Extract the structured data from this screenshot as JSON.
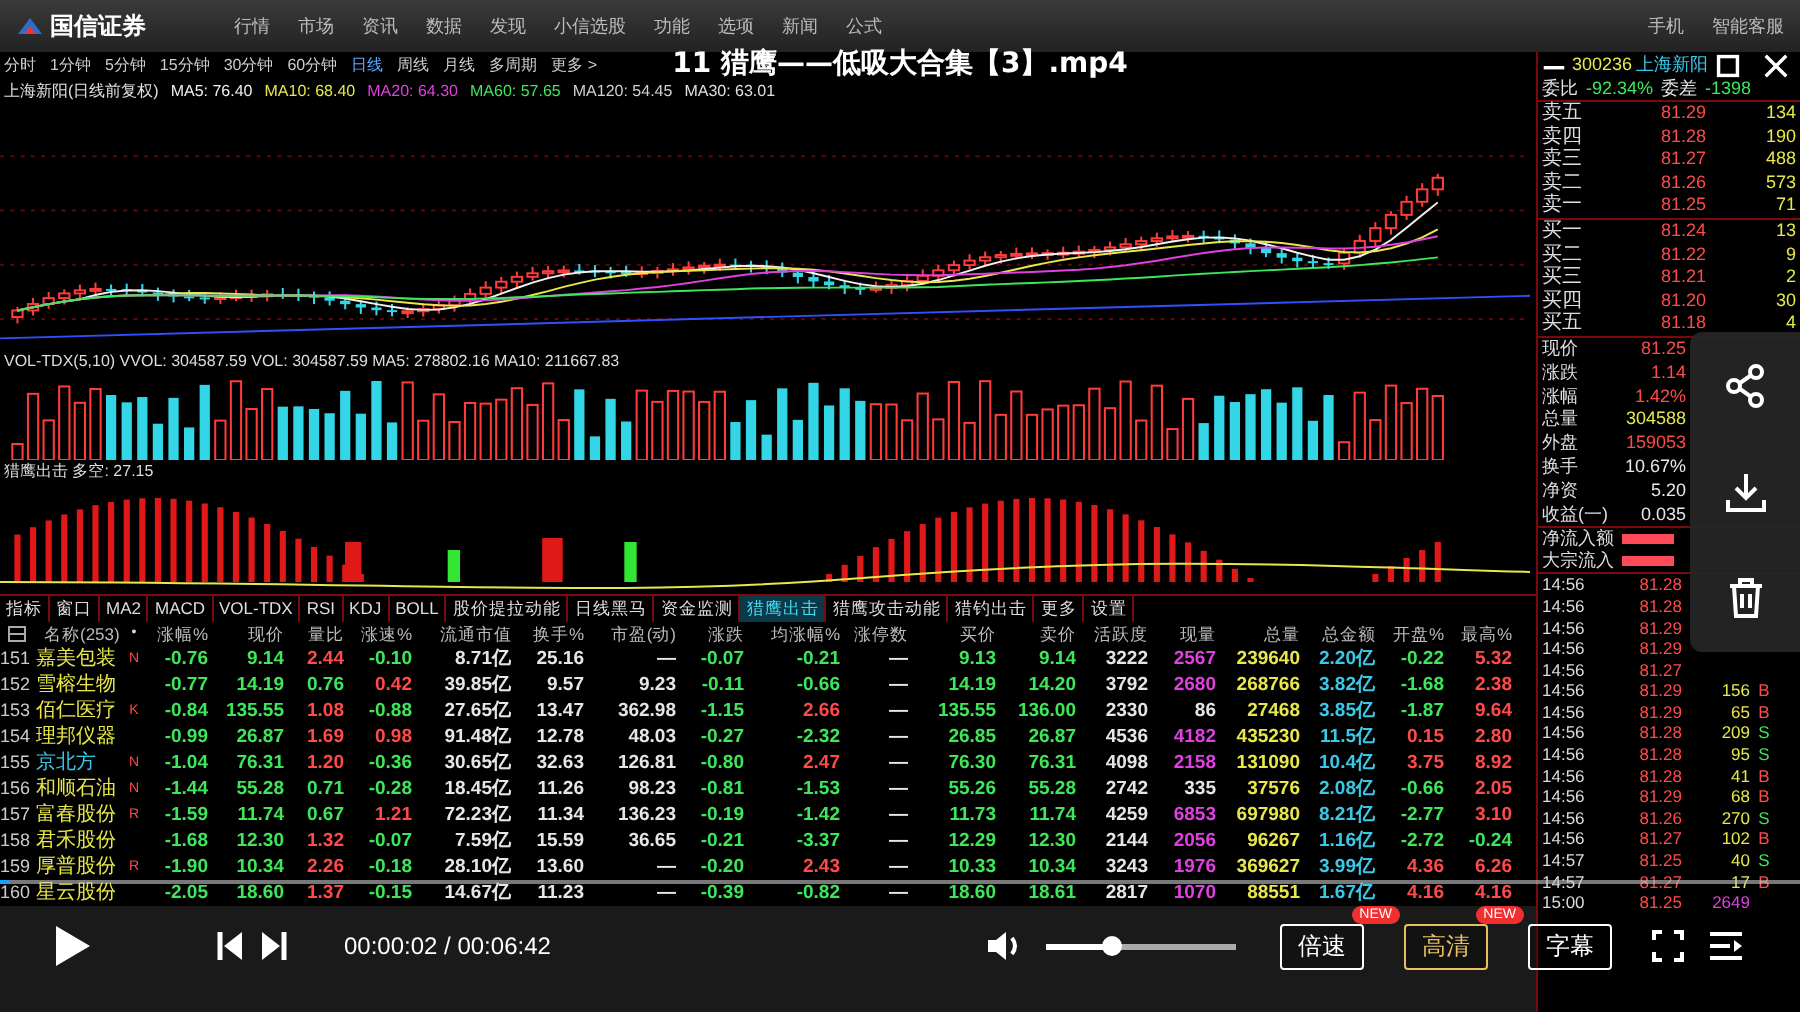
{
  "app": {
    "logo": "国信证券",
    "menu": [
      "行情",
      "市场",
      "资讯",
      "数据",
      "发现",
      "小信选股",
      "功能",
      "选项",
      "新闻",
      "公式"
    ],
    "menu_right": [
      "手机",
      "智能客服"
    ],
    "periods": [
      {
        "label": "分时",
        "selected": false
      },
      {
        "label": "1分钟",
        "selected": false
      },
      {
        "label": "5分钟",
        "selected": false
      },
      {
        "label": "15分钟",
        "selected": false
      },
      {
        "label": "30分钟",
        "selected": false
      },
      {
        "label": "60分钟",
        "selected": false
      },
      {
        "label": "日线",
        "selected": true
      },
      {
        "label": "周线",
        "selected": false
      },
      {
        "label": "月线",
        "selected": false
      },
      {
        "label": "多周期",
        "selected": false
      },
      {
        "label": "更多 >",
        "selected": false
      }
    ],
    "ma_legend": [
      {
        "text": "上海新阳(日线前复权)",
        "color": "#e0e0e0"
      },
      {
        "text": "MA5: 76.40",
        "color": "#f0f0f0"
      },
      {
        "text": "MA10: 68.40",
        "color": "#e8e84a"
      },
      {
        "text": "MA20: 64.30",
        "color": "#e040e0"
      },
      {
        "text": "MA60: 57.65",
        "color": "#3ee65a"
      },
      {
        "text": "MA120: 54.45",
        "color": "#d0d0d0"
      },
      {
        "text": "MA30: 63.01",
        "color": "#e0e0e0"
      }
    ],
    "volume_legend": "VOL-TDX(5,10)  VVOL: 304587.59  VOL: 304587.59  MA5: 278802.16  MA10: 211667.83",
    "indicator_legend": "猎鹰出击  多空: 27.15",
    "indicator_tabs": [
      {
        "label": "指标",
        "selected": false
      },
      {
        "label": "窗口",
        "selected": false
      },
      {
        "label": "MA2",
        "selected": false
      },
      {
        "label": "MACD",
        "selected": false
      },
      {
        "label": "VOL-TDX",
        "selected": false
      },
      {
        "label": "RSI",
        "selected": false
      },
      {
        "label": "KDJ",
        "selected": false
      },
      {
        "label": "BOLL",
        "selected": false
      },
      {
        "label": "股价提拉动能",
        "selected": false
      },
      {
        "label": "日线黑马",
        "selected": false
      },
      {
        "label": "资金监测",
        "selected": false
      },
      {
        "label": "猎鹰出击",
        "selected": true
      },
      {
        "label": "猎鹰攻击动能",
        "selected": false
      },
      {
        "label": "猎钓出击",
        "selected": false
      },
      {
        "label": "更多",
        "selected": false
      },
      {
        "label": "设置",
        "selected": false
      }
    ],
    "table": {
      "columns": [
        "名称(253)",
        "•",
        "涨幅%",
        "现价",
        "量比",
        "涨速%",
        "流通市值",
        "换手%",
        "市盈(动)",
        "涨跌",
        "均涨幅%",
        "涨停数",
        "买价",
        "卖价",
        "活跃度",
        "现量",
        "总量",
        "总金额",
        "开盘%",
        "最高%"
      ],
      "rows": [
        {
          "no": "151",
          "cells": [
            {
              "text": "嘉美包装",
              "color": "#e8e84a"
            },
            {
              "text": "N",
              "color": "#ff4a4a"
            },
            {
              "text": "-0.76",
              "color": "#3ee65a"
            },
            {
              "text": "9.14",
              "color": "#3ee65a"
            },
            {
              "text": "2.44",
              "color": "#ff4a4a"
            },
            {
              "text": "-0.10",
              "color": "#3ee65a"
            },
            {
              "text": "8.71亿",
              "color": "#e6e6e6"
            },
            {
              "text": "25.16",
              "color": "#e6e6e6"
            },
            {
              "text": "—",
              "color": "#e6e6e6"
            },
            {
              "text": "-0.07",
              "color": "#3ee65a"
            },
            {
              "text": "-0.21",
              "color": "#3ee65a"
            },
            {
              "text": "—",
              "color": "#e6e6e6"
            },
            {
              "text": "9.13",
              "color": "#3ee65a"
            },
            {
              "text": "9.14",
              "color": "#3ee65a"
            },
            {
              "text": "3222",
              "color": "#e6e6e6"
            },
            {
              "text": "2567",
              "color": "#e040e0"
            },
            {
              "text": "239640",
              "color": "#e8e84a"
            },
            {
              "text": "2.20亿",
              "color": "#3ac8e8"
            },
            {
              "text": "-0.22",
              "color": "#3ee65a"
            },
            {
              "text": "5.32",
              "color": "#ff4a4a"
            }
          ]
        },
        {
          "no": "152",
          "cells": [
            {
              "text": "雪榕生物",
              "color": "#e8e84a"
            },
            {
              "text": ""
            },
            {
              "text": "-0.77",
              "color": "#3ee65a"
            },
            {
              "text": "14.19",
              "color": "#3ee65a"
            },
            {
              "text": "0.76",
              "color": "#3ee65a"
            },
            {
              "text": "0.42",
              "color": "#ff4a4a"
            },
            {
              "text": "39.85亿",
              "color": "#e6e6e6"
            },
            {
              "text": "9.57",
              "color": "#e6e6e6"
            },
            {
              "text": "9.23",
              "color": "#e6e6e6"
            },
            {
              "text": "-0.11",
              "color": "#3ee65a"
            },
            {
              "text": "-0.66",
              "color": "#3ee65a"
            },
            {
              "text": "—",
              "color": "#e6e6e6"
            },
            {
              "text": "14.19",
              "color": "#3ee65a"
            },
            {
              "text": "14.20",
              "color": "#3ee65a"
            },
            {
              "text": "3792",
              "color": "#e6e6e6"
            },
            {
              "text": "2680",
              "color": "#e040e0"
            },
            {
              "text": "268766",
              "color": "#e8e84a"
            },
            {
              "text": "3.82亿",
              "color": "#3ac8e8"
            },
            {
              "text": "-1.68",
              "color": "#3ee65a"
            },
            {
              "text": "2.38",
              "color": "#ff4a4a"
            }
          ]
        },
        {
          "no": "153",
          "cells": [
            {
              "text": "佰仁医疗",
              "color": "#e8e84a"
            },
            {
              "text": "K",
              "color": "#ff4a4a"
            },
            {
              "text": "-0.84",
              "color": "#3ee65a"
            },
            {
              "text": "135.55",
              "color": "#3ee65a"
            },
            {
              "text": "1.08",
              "color": "#ff4a4a"
            },
            {
              "text": "-0.88",
              "color": "#3ee65a"
            },
            {
              "text": "27.65亿",
              "color": "#e6e6e6"
            },
            {
              "text": "13.47",
              "color": "#e6e6e6"
            },
            {
              "text": "362.98",
              "color": "#e6e6e6"
            },
            {
              "text": "-1.15",
              "color": "#3ee65a"
            },
            {
              "text": "2.66",
              "color": "#ff4a4a"
            },
            {
              "text": "—",
              "color": "#e6e6e6"
            },
            {
              "text": "135.55",
              "color": "#3ee65a"
            },
            {
              "text": "136.00",
              "color": "#3ee65a"
            },
            {
              "text": "2330",
              "color": "#e6e6e6"
            },
            {
              "text": "86",
              "color": "#e6e6e6"
            },
            {
              "text": "27468",
              "color": "#e8e84a"
            },
            {
              "text": "3.85亿",
              "color": "#3ac8e8"
            },
            {
              "text": "-1.87",
              "color": "#3ee65a"
            },
            {
              "text": "9.64",
              "color": "#ff4a4a"
            }
          ]
        },
        {
          "no": "154",
          "cells": [
            {
              "text": "理邦仪器",
              "color": "#e8e84a"
            },
            {
              "text": ""
            },
            {
              "text": "-0.99",
              "color": "#3ee65a"
            },
            {
              "text": "26.87",
              "color": "#3ee65a"
            },
            {
              "text": "1.69",
              "color": "#ff4a4a"
            },
            {
              "text": "0.98",
              "color": "#ff4a4a"
            },
            {
              "text": "91.48亿",
              "color": "#e6e6e6"
            },
            {
              "text": "12.78",
              "color": "#e6e6e6"
            },
            {
              "text": "48.03",
              "color": "#e6e6e6"
            },
            {
              "text": "-0.27",
              "color": "#3ee65a"
            },
            {
              "text": "-2.32",
              "color": "#3ee65a"
            },
            {
              "text": "—",
              "color": "#e6e6e6"
            },
            {
              "text": "26.85",
              "color": "#3ee65a"
            },
            {
              "text": "26.87",
              "color": "#3ee65a"
            },
            {
              "text": "4536",
              "color": "#e6e6e6"
            },
            {
              "text": "4182",
              "color": "#e040e0"
            },
            {
              "text": "435230",
              "color": "#e8e84a"
            },
            {
              "text": "11.5亿",
              "color": "#3ac8e8"
            },
            {
              "text": "0.15",
              "color": "#ff4a4a"
            },
            {
              "text": "2.80",
              "color": "#ff4a4a"
            }
          ]
        },
        {
          "no": "155",
          "cells": [
            {
              "text": "京北方",
              "color": "#3ac8e8"
            },
            {
              "text": "N",
              "color": "#ff4a4a"
            },
            {
              "text": "-1.04",
              "color": "#3ee65a"
            },
            {
              "text": "76.31",
              "color": "#3ee65a"
            },
            {
              "text": "1.20",
              "color": "#ff4a4a"
            },
            {
              "text": "-0.36",
              "color": "#3ee65a"
            },
            {
              "text": "30.65亿",
              "color": "#e6e6e6"
            },
            {
              "text": "32.63",
              "color": "#e6e6e6"
            },
            {
              "text": "126.81",
              "color": "#e6e6e6"
            },
            {
              "text": "-0.80",
              "color": "#3ee65a"
            },
            {
              "text": "2.47",
              "color": "#ff4a4a"
            },
            {
              "text": "—",
              "color": "#e6e6e6"
            },
            {
              "text": "76.30",
              "color": "#3ee65a"
            },
            {
              "text": "76.31",
              "color": "#3ee65a"
            },
            {
              "text": "4098",
              "color": "#e6e6e6"
            },
            {
              "text": "2158",
              "color": "#e040e0"
            },
            {
              "text": "131090",
              "color": "#e8e84a"
            },
            {
              "text": "10.4亿",
              "color": "#3ac8e8"
            },
            {
              "text": "3.75",
              "color": "#ff4a4a"
            },
            {
              "text": "8.92",
              "color": "#ff4a4a"
            }
          ]
        },
        {
          "no": "156",
          "cells": [
            {
              "text": "和顺石油",
              "color": "#e8e84a"
            },
            {
              "text": "N",
              "color": "#ff4a4a"
            },
            {
              "text": "-1.44",
              "color": "#3ee65a"
            },
            {
              "text": "55.28",
              "color": "#3ee65a"
            },
            {
              "text": "0.71",
              "color": "#3ee65a"
            },
            {
              "text": "-0.28",
              "color": "#3ee65a"
            },
            {
              "text": "18.45亿",
              "color": "#e6e6e6"
            },
            {
              "text": "11.26",
              "color": "#e6e6e6"
            },
            {
              "text": "98.23",
              "color": "#e6e6e6"
            },
            {
              "text": "-0.81",
              "color": "#3ee65a"
            },
            {
              "text": "-1.53",
              "color": "#3ee65a"
            },
            {
              "text": "—",
              "color": "#e6e6e6"
            },
            {
              "text": "55.26",
              "color": "#3ee65a"
            },
            {
              "text": "55.28",
              "color": "#3ee65a"
            },
            {
              "text": "2742",
              "color": "#e6e6e6"
            },
            {
              "text": "335",
              "color": "#e6e6e6"
            },
            {
              "text": "37576",
              "color": "#e8e84a"
            },
            {
              "text": "2.08亿",
              "color": "#3ac8e8"
            },
            {
              "text": "-0.66",
              "color": "#3ee65a"
            },
            {
              "text": "2.05",
              "color": "#ff4a4a"
            }
          ]
        },
        {
          "no": "157",
          "cells": [
            {
              "text": "富春股份",
              "color": "#e8e84a"
            },
            {
              "text": "R",
              "color": "#ff4a4a"
            },
            {
              "text": "-1.59",
              "color": "#3ee65a"
            },
            {
              "text": "11.74",
              "color": "#3ee65a"
            },
            {
              "text": "0.67",
              "color": "#3ee65a"
            },
            {
              "text": "1.21",
              "color": "#ff4a4a"
            },
            {
              "text": "72.23亿",
              "color": "#e6e6e6"
            },
            {
              "text": "11.34",
              "color": "#e6e6e6"
            },
            {
              "text": "136.23",
              "color": "#e6e6e6"
            },
            {
              "text": "-0.19",
              "color": "#3ee65a"
            },
            {
              "text": "-1.42",
              "color": "#3ee65a"
            },
            {
              "text": "—",
              "color": "#e6e6e6"
            },
            {
              "text": "11.73",
              "color": "#3ee65a"
            },
            {
              "text": "11.74",
              "color": "#3ee65a"
            },
            {
              "text": "4259",
              "color": "#e6e6e6"
            },
            {
              "text": "6853",
              "color": "#e040e0"
            },
            {
              "text": "697980",
              "color": "#e8e84a"
            },
            {
              "text": "8.21亿",
              "color": "#3ac8e8"
            },
            {
              "text": "-2.77",
              "color": "#3ee65a"
            },
            {
              "text": "3.10",
              "color": "#ff4a4a"
            }
          ]
        },
        {
          "no": "158",
          "cells": [
            {
              "text": "君禾股份",
              "color": "#e8e84a"
            },
            {
              "text": ""
            },
            {
              "text": "-1.68",
              "color": "#3ee65a"
            },
            {
              "text": "12.30",
              "color": "#3ee65a"
            },
            {
              "text": "1.32",
              "color": "#ff4a4a"
            },
            {
              "text": "-0.07",
              "color": "#3ee65a"
            },
            {
              "text": "7.59亿",
              "color": "#e6e6e6"
            },
            {
              "text": "15.59",
              "color": "#e6e6e6"
            },
            {
              "text": "36.65",
              "color": "#e6e6e6"
            },
            {
              "text": "-0.21",
              "color": "#3ee65a"
            },
            {
              "text": "-3.37",
              "color": "#3ee65a"
            },
            {
              "text": "—",
              "color": "#e6e6e6"
            },
            {
              "text": "12.29",
              "color": "#3ee65a"
            },
            {
              "text": "12.30",
              "color": "#3ee65a"
            },
            {
              "text": "2144",
              "color": "#e6e6e6"
            },
            {
              "text": "2056",
              "color": "#e040e0"
            },
            {
              "text": "96267",
              "color": "#e8e84a"
            },
            {
              "text": "1.16亿",
              "color": "#3ac8e8"
            },
            {
              "text": "-2.72",
              "color": "#3ee65a"
            },
            {
              "text": "-0.24",
              "color": "#3ee65a"
            }
          ]
        },
        {
          "no": "159",
          "cells": [
            {
              "text": "厚普股份",
              "color": "#e8e84a"
            },
            {
              "text": "R",
              "color": "#ff4a4a"
            },
            {
              "text": "-1.90",
              "color": "#3ee65a"
            },
            {
              "text": "10.34",
              "color": "#3ee65a"
            },
            {
              "text": "2.26",
              "color": "#ff4a4a"
            },
            {
              "text": "-0.18",
              "color": "#3ee65a"
            },
            {
              "text": "28.10亿",
              "color": "#e6e6e6"
            },
            {
              "text": "13.60",
              "color": "#e6e6e6"
            },
            {
              "text": "—",
              "color": "#e6e6e6"
            },
            {
              "text": "-0.20",
              "color": "#3ee65a"
            },
            {
              "text": "2.43",
              "color": "#ff4a4a"
            },
            {
              "text": "—",
              "color": "#e6e6e6"
            },
            {
              "text": "10.33",
              "color": "#3ee65a"
            },
            {
              "text": "10.34",
              "color": "#3ee65a"
            },
            {
              "text": "3243",
              "color": "#e6e6e6"
            },
            {
              "text": "1976",
              "color": "#e040e0"
            },
            {
              "text": "369627",
              "color": "#e8e84a"
            },
            {
              "text": "3.99亿",
              "color": "#3ac8e8"
            },
            {
              "text": "4.36",
              "color": "#ff4a4a"
            },
            {
              "text": "6.26",
              "color": "#ff4a4a"
            }
          ]
        },
        {
          "no": "160",
          "cells": [
            {
              "text": "星云股份",
              "color": "#e8e84a"
            },
            {
              "text": ""
            },
            {
              "text": "-2.05",
              "color": "#3ee65a"
            },
            {
              "text": "18.60",
              "color": "#3ee65a"
            },
            {
              "text": "1.37",
              "color": "#ff4a4a"
            },
            {
              "text": "-0.15",
              "color": "#3ee65a"
            },
            {
              "text": "14.67亿",
              "color": "#e6e6e6"
            },
            {
              "text": "11.23",
              "color": "#e6e6e6"
            },
            {
              "text": "—",
              "color": "#e6e6e6"
            },
            {
              "text": "-0.39",
              "color": "#3ee65a"
            },
            {
              "text": "-0.82",
              "color": "#3ee65a"
            },
            {
              "text": "—",
              "color": "#e6e6e6"
            },
            {
              "text": "18.60",
              "color": "#3ee65a"
            },
            {
              "text": "18.61",
              "color": "#3ee65a"
            },
            {
              "text": "2817",
              "color": "#e6e6e6"
            },
            {
              "text": "1070",
              "color": "#e040e0"
            },
            {
              "text": "88551",
              "color": "#e8e84a"
            },
            {
              "text": "1.67亿",
              "color": "#3ac8e8"
            },
            {
              "text": "4.16",
              "color": "#ff4a4a"
            },
            {
              "text": "4.16",
              "color": "#ff4a4a"
            }
          ]
        }
      ]
    },
    "quote": {
      "code": "300236",
      "name": "上海新阳",
      "ratio": [
        {
          "text": "委比",
          "color": "#e6e6e6"
        },
        {
          "text": "-92.34%",
          "color": "#3ee65a"
        },
        {
          "text": "委差",
          "color": "#e6e6e6"
        },
        {
          "text": "-1398",
          "color": "#3ee65a"
        }
      ],
      "asks": [
        {
          "label": "卖五",
          "price": "81.29",
          "volume": "134"
        },
        {
          "label": "卖四",
          "price": "81.28",
          "volume": "190"
        },
        {
          "label": "卖三",
          "price": "81.27",
          "volume": "488"
        },
        {
          "label": "卖二",
          "price": "81.26",
          "volume": "573"
        },
        {
          "label": "卖一",
          "price": "81.25",
          "volume": "71"
        }
      ],
      "bids": [
        {
          "label": "买一",
          "price": "81.24",
          "volume": "13"
        },
        {
          "label": "买二",
          "price": "81.22",
          "volume": "9"
        },
        {
          "label": "买三",
          "price": "81.21",
          "volume": "2"
        },
        {
          "label": "买四",
          "price": "81.20",
          "volume": "30"
        },
        {
          "label": "买五",
          "price": "81.18",
          "volume": "4"
        }
      ],
      "stats": [
        {
          "label": "现价",
          "value": "81.25",
          "color": "#ff4a4a"
        },
        {
          "label": "涨跌",
          "value": "1.14",
          "color": "#ff4a4a"
        },
        {
          "label": "涨幅",
          "value": "1.42%",
          "color": "#ff4a4a"
        },
        {
          "label": "总量",
          "value": "304588",
          "color": "#e8e84a"
        },
        {
          "label": "外盘",
          "value": "159053",
          "color": "#ff4a4a"
        },
        {
          "label": "换手",
          "value": "10.67%",
          "color": "#e6e6e6"
        },
        {
          "label": "净资",
          "value": "5.20",
          "color": "#e6e6e6"
        },
        {
          "label": "收益(一)",
          "value": "0.035",
          "color": "#e6e6e6"
        }
      ],
      "flows": [
        "净流入额",
        "大宗流入"
      ],
      "ticks": [
        {
          "time": "14:56",
          "price": "81.28"
        },
        {
          "time": "14:56",
          "price": "81.28"
        },
        {
          "time": "14:56",
          "price": "81.29"
        },
        {
          "time": "14:56",
          "price": "81.29"
        },
        {
          "time": "14:56",
          "price": "81.27"
        },
        {
          "time": "14:56",
          "price": "81.29",
          "volume": "156",
          "side": "B",
          "kind": "buy"
        },
        {
          "time": "14:56",
          "price": "81.29",
          "volume": "65",
          "side": "B",
          "kind": "buy"
        },
        {
          "time": "14:56",
          "price": "81.28",
          "volume": "209",
          "side": "S",
          "kind": "sell"
        },
        {
          "time": "14:56",
          "price": "81.28",
          "volume": "95",
          "side": "S",
          "kind": "sell"
        },
        {
          "time": "14:56",
          "price": "81.28",
          "volume": "41",
          "side": "B",
          "kind": "buy"
        },
        {
          "time": "14:56",
          "price": "81.29",
          "volume": "68",
          "side": "B",
          "kind": "buy"
        },
        {
          "time": "14:56",
          "price": "81.26",
          "volume": "270",
          "side": "S",
          "kind": "sell"
        },
        {
          "time": "14:56",
          "price": "81.27",
          "volume": "102",
          "side": "B",
          "kind": "buy"
        },
        {
          "time": "14:57",
          "price": "81.25",
          "volume": "40",
          "side": "S",
          "kind": "sell"
        },
        {
          "time": "14:57",
          "price": "81.27",
          "volume": "17",
          "side": "B",
          "kind": "buy"
        },
        {
          "time": "15:00",
          "price": "81.25",
          "volume": "2649",
          "kind": "close"
        }
      ]
    }
  },
  "player": {
    "title": "11 猎鹰——低吸大合集【3】.mp4",
    "time": "00:00:02 / 00:06:42",
    "progress": {
      "level": 0.006
    },
    "volume": {
      "level": 0.35
    },
    "buttons": [
      {
        "label": "倍速",
        "badge": "NEW",
        "selected": false
      },
      {
        "label": "高清",
        "badge": "NEW",
        "selected": true
      },
      {
        "label": "字幕",
        "selected": false
      }
    ]
  }
}
